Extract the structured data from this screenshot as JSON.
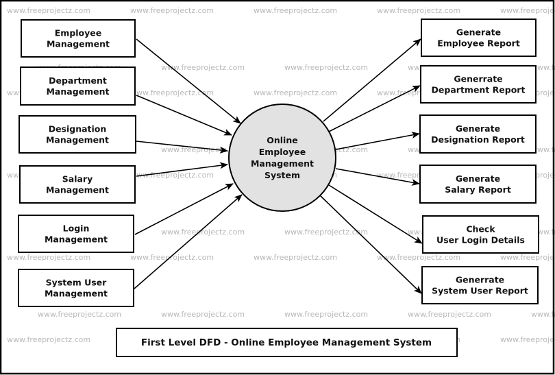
{
  "watermark": {
    "text": "www.freeprojectz.com",
    "color": "#b8b8b8"
  },
  "diagram": {
    "title": "First Level DFD - Online Employee Management System",
    "process": {
      "lines": [
        "Online",
        "Employee",
        "Management",
        "System"
      ],
      "fill": "#e2e2e2"
    },
    "inputs": [
      {
        "id": "employee",
        "lines": [
          "Employee",
          "Management"
        ]
      },
      {
        "id": "department",
        "lines": [
          "Department",
          "Management"
        ]
      },
      {
        "id": "designation",
        "lines": [
          "Designation",
          "Management"
        ]
      },
      {
        "id": "salary",
        "lines": [
          "Salary",
          "Management"
        ]
      },
      {
        "id": "login",
        "lines": [
          "Login",
          "Management"
        ]
      },
      {
        "id": "system-user",
        "lines": [
          "System User",
          "Management"
        ]
      }
    ],
    "outputs": [
      {
        "id": "employee-report",
        "lines": [
          "Generate",
          "Employee Report"
        ]
      },
      {
        "id": "department-report",
        "lines": [
          "Generrate",
          "Department Report"
        ]
      },
      {
        "id": "designation-report",
        "lines": [
          "Generate",
          "Designation Report"
        ]
      },
      {
        "id": "salary-report",
        "lines": [
          "Generate",
          "Salary Report"
        ]
      },
      {
        "id": "login-details",
        "lines": [
          "Check",
          "User Login Details"
        ]
      },
      {
        "id": "system-user-report",
        "lines": [
          "Generrate",
          "System User Report"
        ]
      }
    ],
    "flows": [
      {
        "from": "employee",
        "to": "process"
      },
      {
        "from": "department",
        "to": "process"
      },
      {
        "from": "designation",
        "to": "process"
      },
      {
        "from": "salary",
        "to": "process"
      },
      {
        "from": "login",
        "to": "process"
      },
      {
        "from": "system-user",
        "to": "process"
      },
      {
        "from": "process",
        "to": "employee-report"
      },
      {
        "from": "process",
        "to": "department-report"
      },
      {
        "from": "process",
        "to": "designation-report"
      },
      {
        "from": "process",
        "to": "salary-report"
      },
      {
        "from": "process",
        "to": "login-details"
      },
      {
        "from": "process",
        "to": "system-user-report"
      }
    ]
  }
}
